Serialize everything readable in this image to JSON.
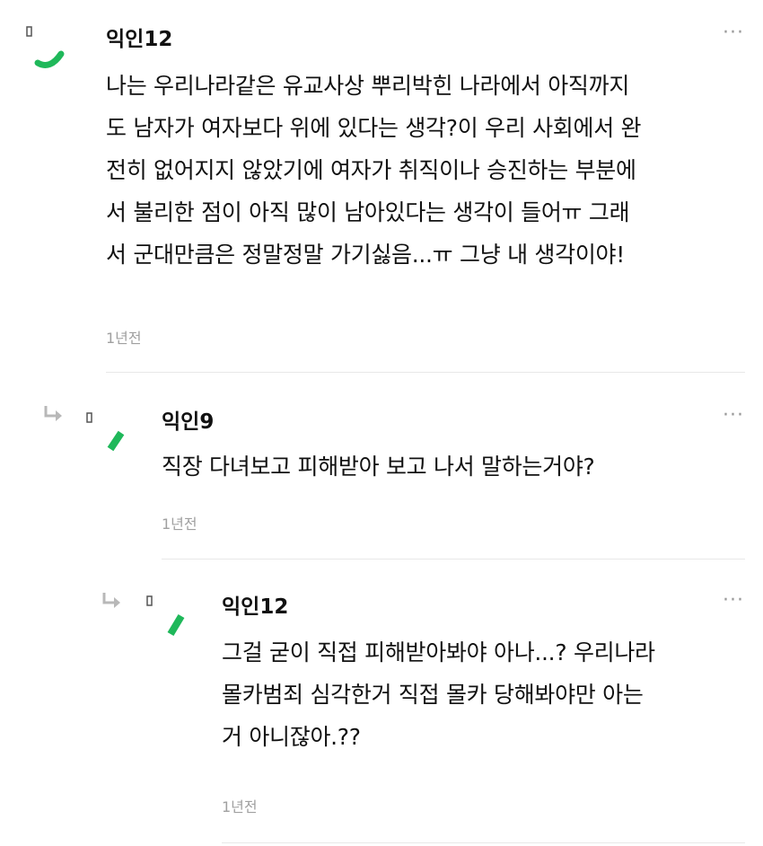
{
  "comments": [
    {
      "username": "익인12",
      "lines": [
        "나는 우리나라같은 유교사상 뿌리박힌 나라에서 아직까지",
        "도 남자가 여자보다 위에 있다는 생각?이 우리 사회에서 완",
        "전히 없어지지 않았기에 여자가 취직이나 승진하는 부분에",
        "서 불리한 점이 아직 많이 남아있다는 생각이 들어ㅠ 그래",
        "서 군대만큼은 정말정말 가기싫음...ㅠ 그냥 내 생각이야!"
      ],
      "time": "1년전",
      "avatar_color": "#1fb85a"
    },
    {
      "username": "익인9",
      "lines": [
        "직장 다녀보고 피해받아 보고 나서 말하는거야?"
      ],
      "time": "1년전",
      "avatar_color": "#1fb85a"
    },
    {
      "username": "익인12",
      "lines": [
        "그걸 굳이 직접 피해받아봐야 아나...? 우리나라",
        "몰카범죄 심각한거 직접 몰카 당해봐야만 아는",
        "거 아니잖아.??"
      ],
      "time": "1년전",
      "avatar_color": "#1fb85a"
    }
  ],
  "more_label": "···",
  "icons": {
    "more": "more-options-icon",
    "reply": "reply-arrow-icon"
  }
}
